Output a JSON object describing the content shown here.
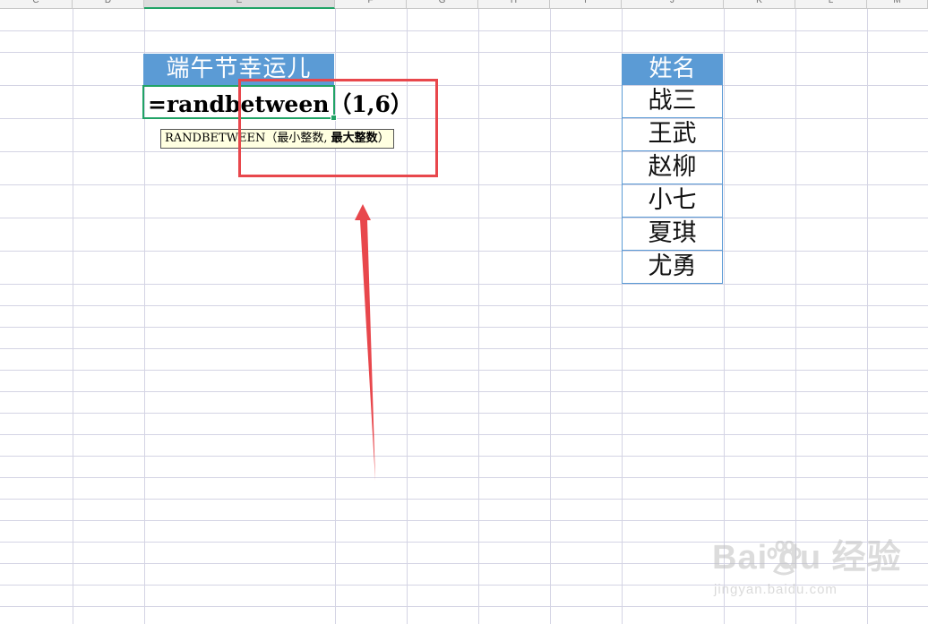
{
  "columns": [
    "C",
    "D",
    "E",
    "F",
    "G",
    "H",
    "I",
    "J",
    "K",
    "L",
    "M"
  ],
  "active_column": "E",
  "title_cell": "端午节幸运儿",
  "formula": "=randbetween（1,6）",
  "tooltip": {
    "func": "RANDBETWEEN",
    "args_prefix": "（最小整数, ",
    "args_bold": "最大整数",
    "args_suffix": "）"
  },
  "names_table": {
    "header": "姓名",
    "names": [
      "战三",
      "王武",
      "赵柳",
      "小七",
      "夏琪",
      "尤勇"
    ]
  },
  "accent_colors": {
    "header_fill": "#5b9bd5",
    "annotation_red": "#e8474c",
    "selection_green": "#21a366",
    "tooltip_bg": "#ffffe1"
  },
  "watermark": {
    "logo": "Bai du 经验",
    "url": "jingyan.baidu.com"
  }
}
